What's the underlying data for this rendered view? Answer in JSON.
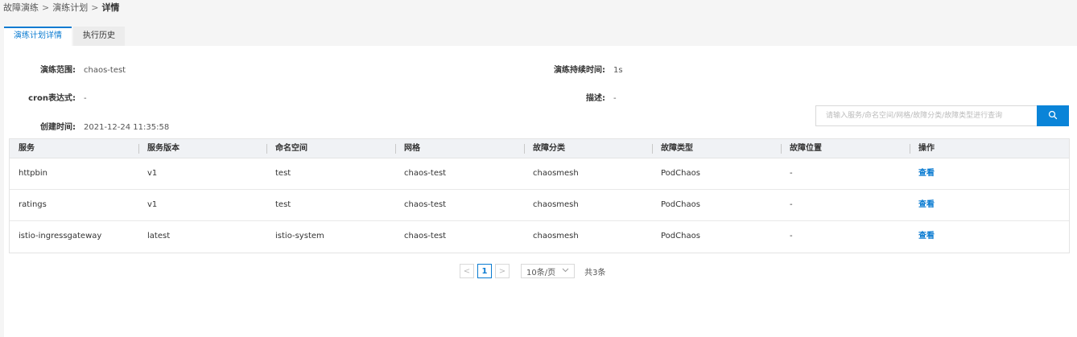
{
  "breadcrumb": {
    "items": [
      "故障演练",
      "演练计划"
    ],
    "current": "详情",
    "separator": ">"
  },
  "tabs": [
    {
      "label": "演练计划详情",
      "active": true
    },
    {
      "label": "执行历史",
      "active": false
    }
  ],
  "info": {
    "scope_label": "演练范围:",
    "scope_value": "chaos-test",
    "duration_label": "演练持续时间:",
    "duration_value": "1s",
    "cron_label": "cron表达式:",
    "cron_value": "-",
    "desc_label": "描述:",
    "desc_value": "-",
    "created_label": "创建时间:",
    "created_value": "2021-12-24 11:35:58"
  },
  "search": {
    "placeholder": "请输入服务/命名空间/网格/故障分类/故障类型进行查询",
    "value": "",
    "icon": "search-icon"
  },
  "table": {
    "columns": [
      "服务",
      "服务版本",
      "命名空间",
      "网格",
      "故障分类",
      "故障类型",
      "故障位置",
      "操作"
    ],
    "rows": [
      {
        "service": "httpbin",
        "version": "v1",
        "namespace": "test",
        "mesh": "chaos-test",
        "category": "chaosmesh",
        "type": "PodChaos",
        "location": "-",
        "action": "查看"
      },
      {
        "service": "ratings",
        "version": "v1",
        "namespace": "test",
        "mesh": "chaos-test",
        "category": "chaosmesh",
        "type": "PodChaos",
        "location": "-",
        "action": "查看"
      },
      {
        "service": "istio-ingressgateway",
        "version": "latest",
        "namespace": "istio-system",
        "mesh": "chaos-test",
        "category": "chaosmesh",
        "type": "PodChaos",
        "location": "-",
        "action": "查看"
      }
    ]
  },
  "pagination": {
    "prev": "<",
    "next": ">",
    "current_page": "1",
    "page_size": "10条/页",
    "total": "共3条"
  },
  "colors": {
    "accent": "#0a7bd1",
    "search_button": "#0a84d8",
    "header_bg": "#f0f2f5",
    "page_bg": "#f5f5f5"
  }
}
